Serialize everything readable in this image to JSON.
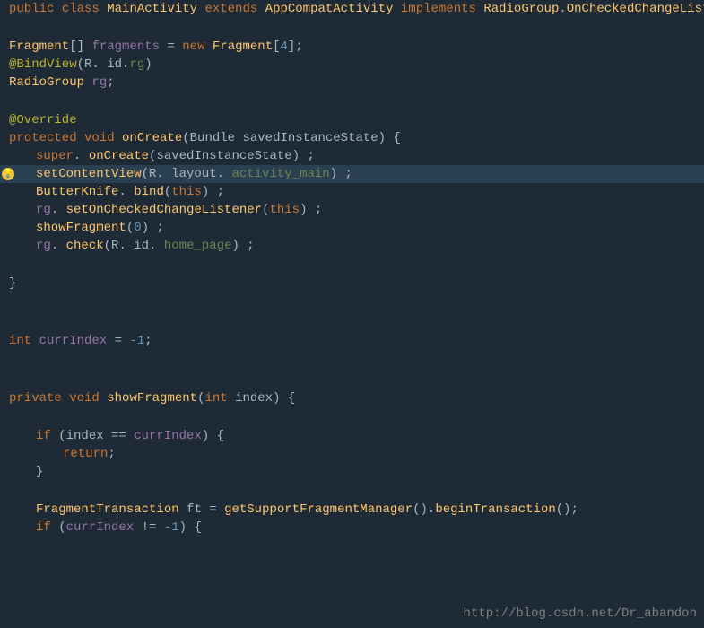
{
  "colors": {
    "background": "#1e2a35",
    "highlight_bg": "#2a3f50",
    "keyword": "#cc7832",
    "annotation": "#bbb529",
    "class_name": "#ffc66d",
    "field": "#9876aa",
    "string": "#6a8759",
    "number": "#6897bb",
    "plain": "#a9b7c6",
    "bulb": "#f0c040"
  },
  "url_text": "http://blog.csdn.net/Dr_abandon"
}
